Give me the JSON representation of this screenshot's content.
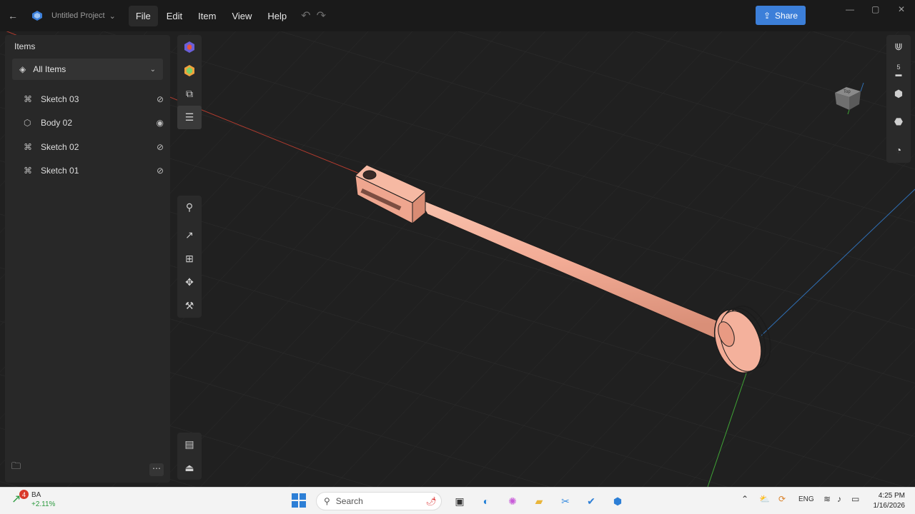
{
  "titlebar": {
    "project_name": "Untitled Project",
    "menu": [
      "File",
      "Edit",
      "Item",
      "View",
      "Help"
    ],
    "share_label": "Share"
  },
  "items_panel": {
    "title": "Items",
    "filter_label": "All Items",
    "items": [
      {
        "label": "Sketch 03",
        "kind": "sketch",
        "visible": false
      },
      {
        "label": "Body 02",
        "kind": "body",
        "visible": true
      },
      {
        "label": "Sketch 02",
        "kind": "sketch",
        "visible": false
      },
      {
        "label": "Sketch 01",
        "kind": "sketch",
        "visible": false
      }
    ]
  },
  "right_toolbar": {
    "snap_value": "5"
  },
  "colors": {
    "model": "#f2ab95",
    "accent": "#3c7fd9",
    "x_axis": "#b23b2e",
    "y_axis": "#2f6fb5",
    "z_axis": "#3fa335"
  },
  "taskbar": {
    "ticker_symbol": "BA",
    "ticker_change": "+2.11%",
    "ticker_badge": "4",
    "search_placeholder": "Search",
    "language": "ENG",
    "time": "4:25 PM",
    "date": "1/16/2026"
  }
}
